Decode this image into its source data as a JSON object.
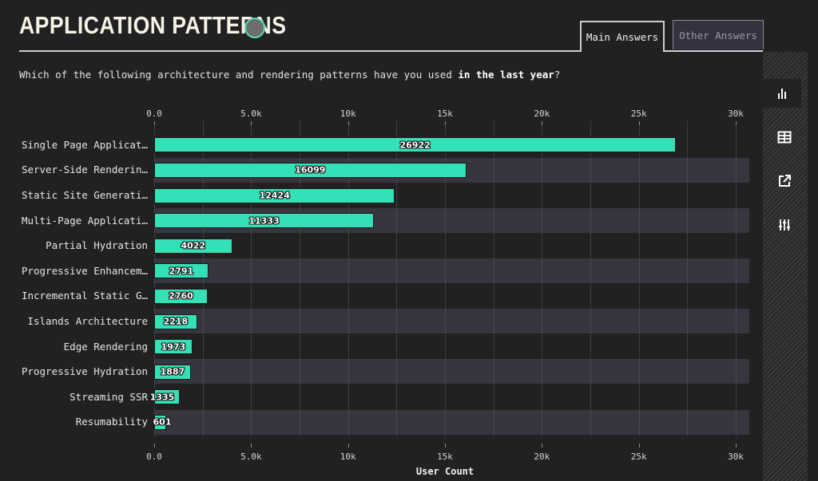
{
  "header": {
    "title": "APPLICATION PATTERNS",
    "logo_icon": "survey-badge-icon"
  },
  "tabs": [
    {
      "label": "Main Answers",
      "active": true
    },
    {
      "label": "Other Answers",
      "active": false
    }
  ],
  "question": {
    "prefix": "Which of the following architecture and rendering patterns have you used ",
    "emphasis": "in the last year",
    "suffix": "?"
  },
  "sidebar": {
    "items": [
      {
        "icon": "bar-chart-icon",
        "active": true
      },
      {
        "icon": "table-icon",
        "active": false
      },
      {
        "icon": "external-link-icon",
        "active": false
      },
      {
        "icon": "sliders-icon",
        "active": false
      }
    ]
  },
  "colors": {
    "bar": "#34e0b6",
    "row_alt": "#38353f",
    "background": "#222122"
  },
  "chart_data": {
    "type": "bar",
    "orientation": "horizontal",
    "title": "",
    "xlabel": "User Count",
    "ylabel": "",
    "xlim": [
      0,
      30500
    ],
    "x_ticks": [
      "0.0",
      "5.0k",
      "10k",
      "15k",
      "20k",
      "25k",
      "30k"
    ],
    "x_tick_values": [
      0,
      5000,
      10000,
      15000,
      20000,
      25000,
      30000
    ],
    "grid": true,
    "categories": [
      "Single Page Applicat…",
      "Server-Side Renderin…",
      "Static Site Generati…",
      "Multi-Page Applicati…",
      "Partial Hydration",
      "Progressive Enhancem…",
      "Incremental Static G…",
      "Islands Architecture",
      "Edge Rendering",
      "Progressive Hydration",
      "Streaming SSR",
      "Resumability"
    ],
    "values": [
      26922,
      16099,
      12424,
      11333,
      4022,
      2791,
      2760,
      2218,
      1973,
      1887,
      1335,
      601
    ]
  }
}
